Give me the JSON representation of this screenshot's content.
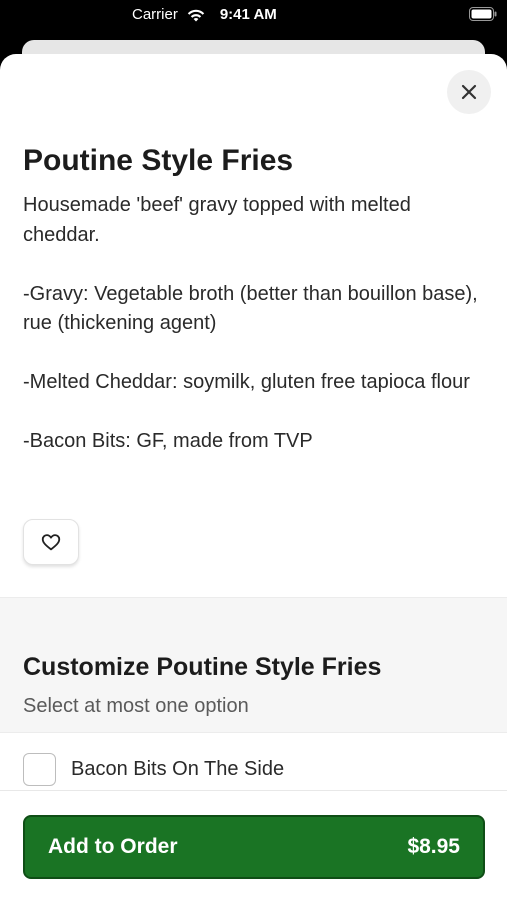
{
  "status_bar": {
    "carrier": "Carrier",
    "time": "9:41 AM"
  },
  "item": {
    "title": "Poutine Style Fries",
    "description": [
      "Housemade 'beef' gravy topped with melted cheddar.",
      "-Gravy: Vegetable broth (better than bouillon base), rue (thickening agent)",
      "-Melted Cheddar: soymilk, gluten free tapioca flour",
      "-Bacon Bits: GF, made from TVP"
    ]
  },
  "customize": {
    "title": "Customize Poutine Style Fries",
    "subtitle": "Select at most one option",
    "options": [
      {
        "label": "Bacon Bits On The Side",
        "checked": false
      }
    ]
  },
  "order": {
    "button_label": "Add to Order",
    "price": "$8.95"
  },
  "colors": {
    "accent_green": "#1a7424",
    "sheet_background": "#ffffff",
    "section_background": "#f6f6f6"
  },
  "icons": {
    "close": "close-icon",
    "favorite": "heart-icon",
    "wifi": "wifi-icon",
    "battery": "battery-icon"
  }
}
